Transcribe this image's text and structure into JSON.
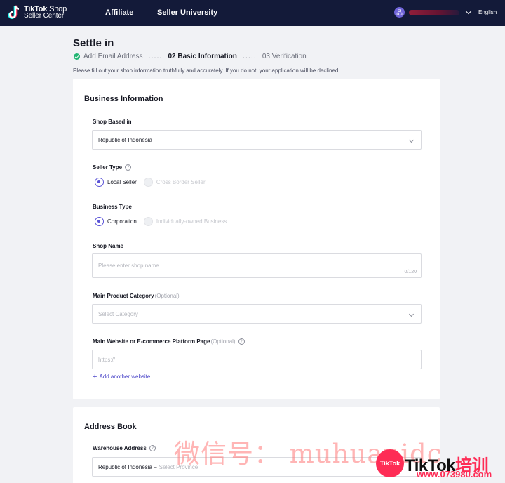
{
  "nav": {
    "logo_title": "TikTok",
    "logo_title_shop": "Shop",
    "logo_subtitle": "Seller Center",
    "links": [
      "Affiliate",
      "Seller University"
    ],
    "avatar_initial": "品",
    "language": "English"
  },
  "page": {
    "title": "Settle in",
    "steps": [
      {
        "label": "Add Email Address",
        "status": "done"
      },
      {
        "label": "02 Basic Information",
        "status": "current"
      },
      {
        "label": "03 Verification",
        "status": "todo"
      }
    ],
    "step_separator": "·····",
    "notice": "Please fill out your shop information truthfully and accurately. If you do not, your application will be declined."
  },
  "business": {
    "section_title": "Business Information",
    "shop_based_in": {
      "label": "Shop Based in",
      "value": "Republic of Indonesia"
    },
    "seller_type": {
      "label": "Seller Type",
      "options": [
        {
          "label": "Local Seller",
          "selected": true
        },
        {
          "label": "Cross Border Seller",
          "selected": false
        }
      ]
    },
    "business_type": {
      "label": "Business Type",
      "options": [
        {
          "label": "Corporation",
          "selected": true
        },
        {
          "label": "Individually-owned Business",
          "selected": false
        }
      ]
    },
    "shop_name": {
      "label": "Shop Name",
      "placeholder": "Please enter shop name",
      "counter": "0/120"
    },
    "main_category": {
      "label": "Main Product Category",
      "optional": "(Optional)",
      "placeholder": "Select Category"
    },
    "website": {
      "label": "Main Website or E-commerce Platform Page",
      "optional": "(Optional)",
      "placeholder": "https://"
    },
    "add_website": "Add another website"
  },
  "address": {
    "section_title": "Address Book",
    "warehouse": {
      "label": "Warehouse Address",
      "value": "Republic of Indonesia – ",
      "placeholder": "Select Province"
    }
  },
  "watermark": {
    "text": "微信号： muhuanidc",
    "badge": "TikTok",
    "brand": "TikTok",
    "brand_cn": "培训",
    "url": "www.073980.com"
  },
  "colors": {
    "nav_bg": "#131a39",
    "accent": "#5a53d6",
    "success": "#22b573",
    "link": "#4a45c8"
  },
  "icons": [
    "tiktok-logo-icon",
    "chevron-down-icon",
    "check-circle-icon",
    "help-icon",
    "plus-icon"
  ]
}
